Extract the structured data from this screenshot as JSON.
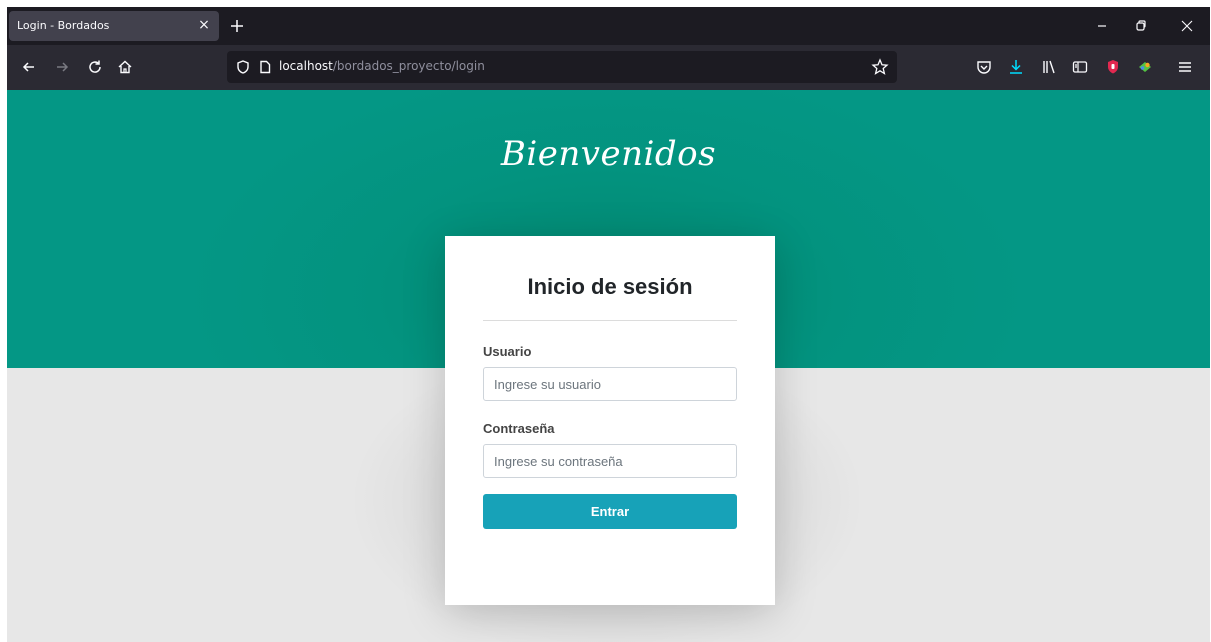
{
  "browser": {
    "tab": {
      "title": "Login - Bordados",
      "close_label": "×"
    },
    "url": {
      "host": "localhost",
      "path": "/bordados_proyecto/login"
    },
    "icons": {
      "back": "arrow-left-icon",
      "forward": "arrow-right-icon",
      "reload": "reload-icon",
      "home": "home-icon",
      "shield": "tracking-shield-icon",
      "page": "page-icon",
      "bookmark": "star-icon",
      "pocket": "pocket-icon",
      "downloads": "download-icon",
      "library": "library-icon",
      "sidebar": "sidebar-icon",
      "ext_red": "red-extension-icon",
      "ext_green": "green-extension-icon",
      "menu": "hamburger-menu-icon",
      "minimize": "minimize-icon",
      "restore": "restore-icon",
      "close": "close-icon",
      "new_tab": "plus-icon"
    },
    "colors": {
      "download_accent": "#0df",
      "ext_red": "#e22850",
      "ext_green": "#54c243"
    }
  },
  "page": {
    "welcome": "Bienvenidos",
    "colors": {
      "hero": "#03937f",
      "button": "#17a2b8",
      "background": "#e7e7e7"
    },
    "login": {
      "title": "Inicio de sesión",
      "username_label": "Usuario",
      "username_placeholder": "Ingrese su usuario",
      "password_label": "Contraseña",
      "password_placeholder": "Ingrese su contraseña",
      "submit_label": "Entrar"
    }
  }
}
